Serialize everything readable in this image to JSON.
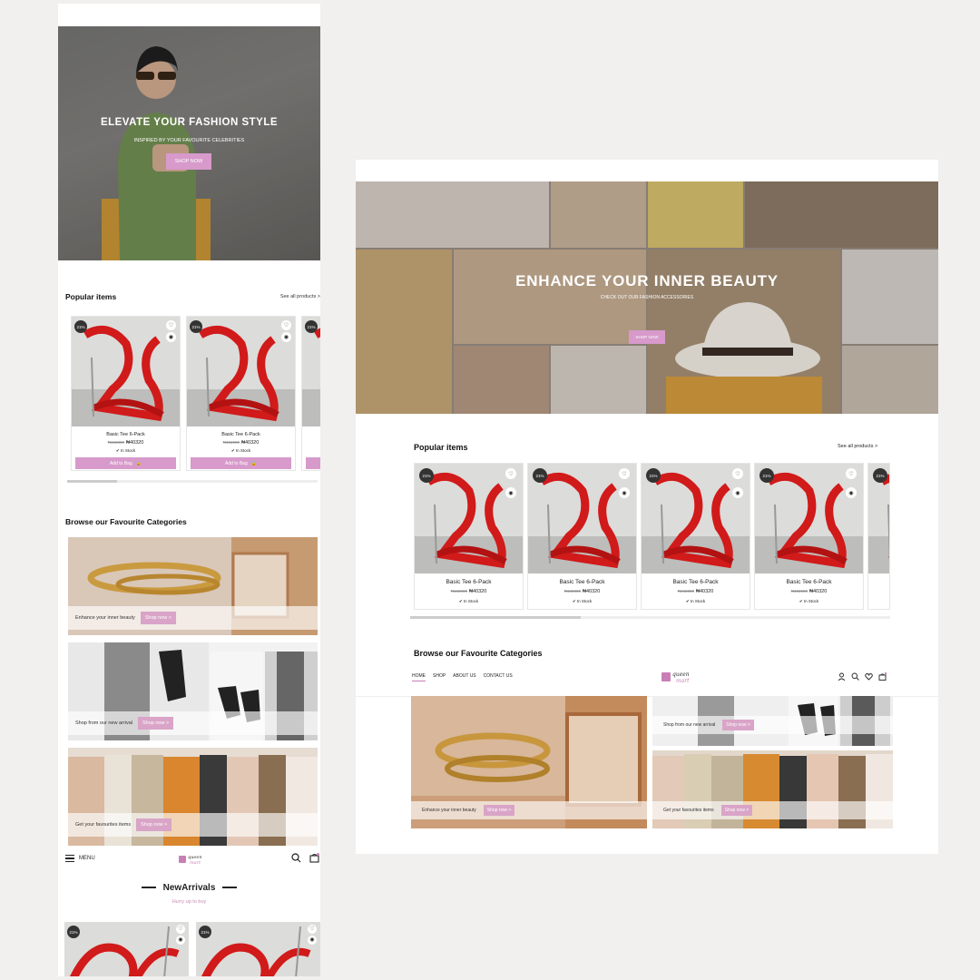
{
  "mobile": {
    "hero": {
      "title": "ELEVATE YOUR FASHION STYLE",
      "subtitle": "INSPIRED BY YOUR FAVOURITE CELEBRITIES",
      "button": "SHOP NOW"
    },
    "popular": {
      "title": "Popular items",
      "see_all": "See all products >"
    },
    "products": [
      {
        "badge": "21%",
        "name": "Basic Tee 6-Pack",
        "old_price": "₦192000",
        "price": "₦40320",
        "stock": "In Stock",
        "button": "Add to Bag"
      },
      {
        "badge": "21%",
        "name": "Basic Tee 6-Pack",
        "old_price": "₦192000",
        "price": "₦40320",
        "stock": "In Stock",
        "button": "Add to Bag"
      },
      {
        "badge": "21%"
      }
    ],
    "categories": {
      "title": "Browse our Favourite Categories",
      "items": [
        {
          "label": "Enhance your inner beauty",
          "button": "Shop now >"
        },
        {
          "label": "Shop from our new arrival",
          "button": "Shop now >"
        },
        {
          "label": "Get your favourites items",
          "button": "Shop now >"
        }
      ]
    },
    "nav": {
      "menu": "MENU",
      "logo_top": "queen",
      "logo_bottom": "mart"
    },
    "new_arrivals": {
      "title": "NewArrivals",
      "subtitle": "Hurry up to buy",
      "badges": [
        "21%",
        "21%"
      ]
    }
  },
  "desktop": {
    "hero": {
      "title": "ENHANCE YOUR INNER BEAUTY",
      "subtitle": "CHECK OUT OUR FASHION ACCESSORIES",
      "button": "SHOP NOW"
    },
    "popular": {
      "title": "Popular items",
      "see_all": "See all products >"
    },
    "products": [
      {
        "badge": "21%",
        "name": "Basic Tee 6-Pack",
        "old_price": "₦192000",
        "price": "₦40320",
        "stock": "In Stock"
      },
      {
        "badge": "21%",
        "name": "Basic Tee 6-Pack",
        "old_price": "₦192000",
        "price": "₦40320",
        "stock": "In Stock"
      },
      {
        "badge": "21%",
        "name": "Basic Tee 6-Pack",
        "old_price": "₦192000",
        "price": "₦40320",
        "stock": "In Stock"
      },
      {
        "badge": "21%",
        "name": "Basic Tee 6-Pack",
        "old_price": "₦192000",
        "price": "₦40320",
        "stock": "In Stock"
      },
      {
        "badge": "21%"
      }
    ],
    "categories": {
      "title": "Browse our Favourite Categories",
      "items": [
        {
          "label": "Enhance your inner beauty",
          "button": "Shop now >"
        },
        {
          "label": "Shop from our new arrival",
          "button": "Shop now >"
        },
        {
          "label": "Get your favourites items",
          "button": "Shop now >"
        }
      ]
    },
    "nav": {
      "links": [
        "HOME",
        "SHOP",
        "ABOUT US",
        "CONTACT US"
      ],
      "logo_top": "queen",
      "logo_bottom": "mart"
    }
  },
  "colors": {
    "accent": "#d79acb",
    "accent_text": "#c88cb8",
    "background": "#f1f0ef",
    "badge": "#333333"
  }
}
